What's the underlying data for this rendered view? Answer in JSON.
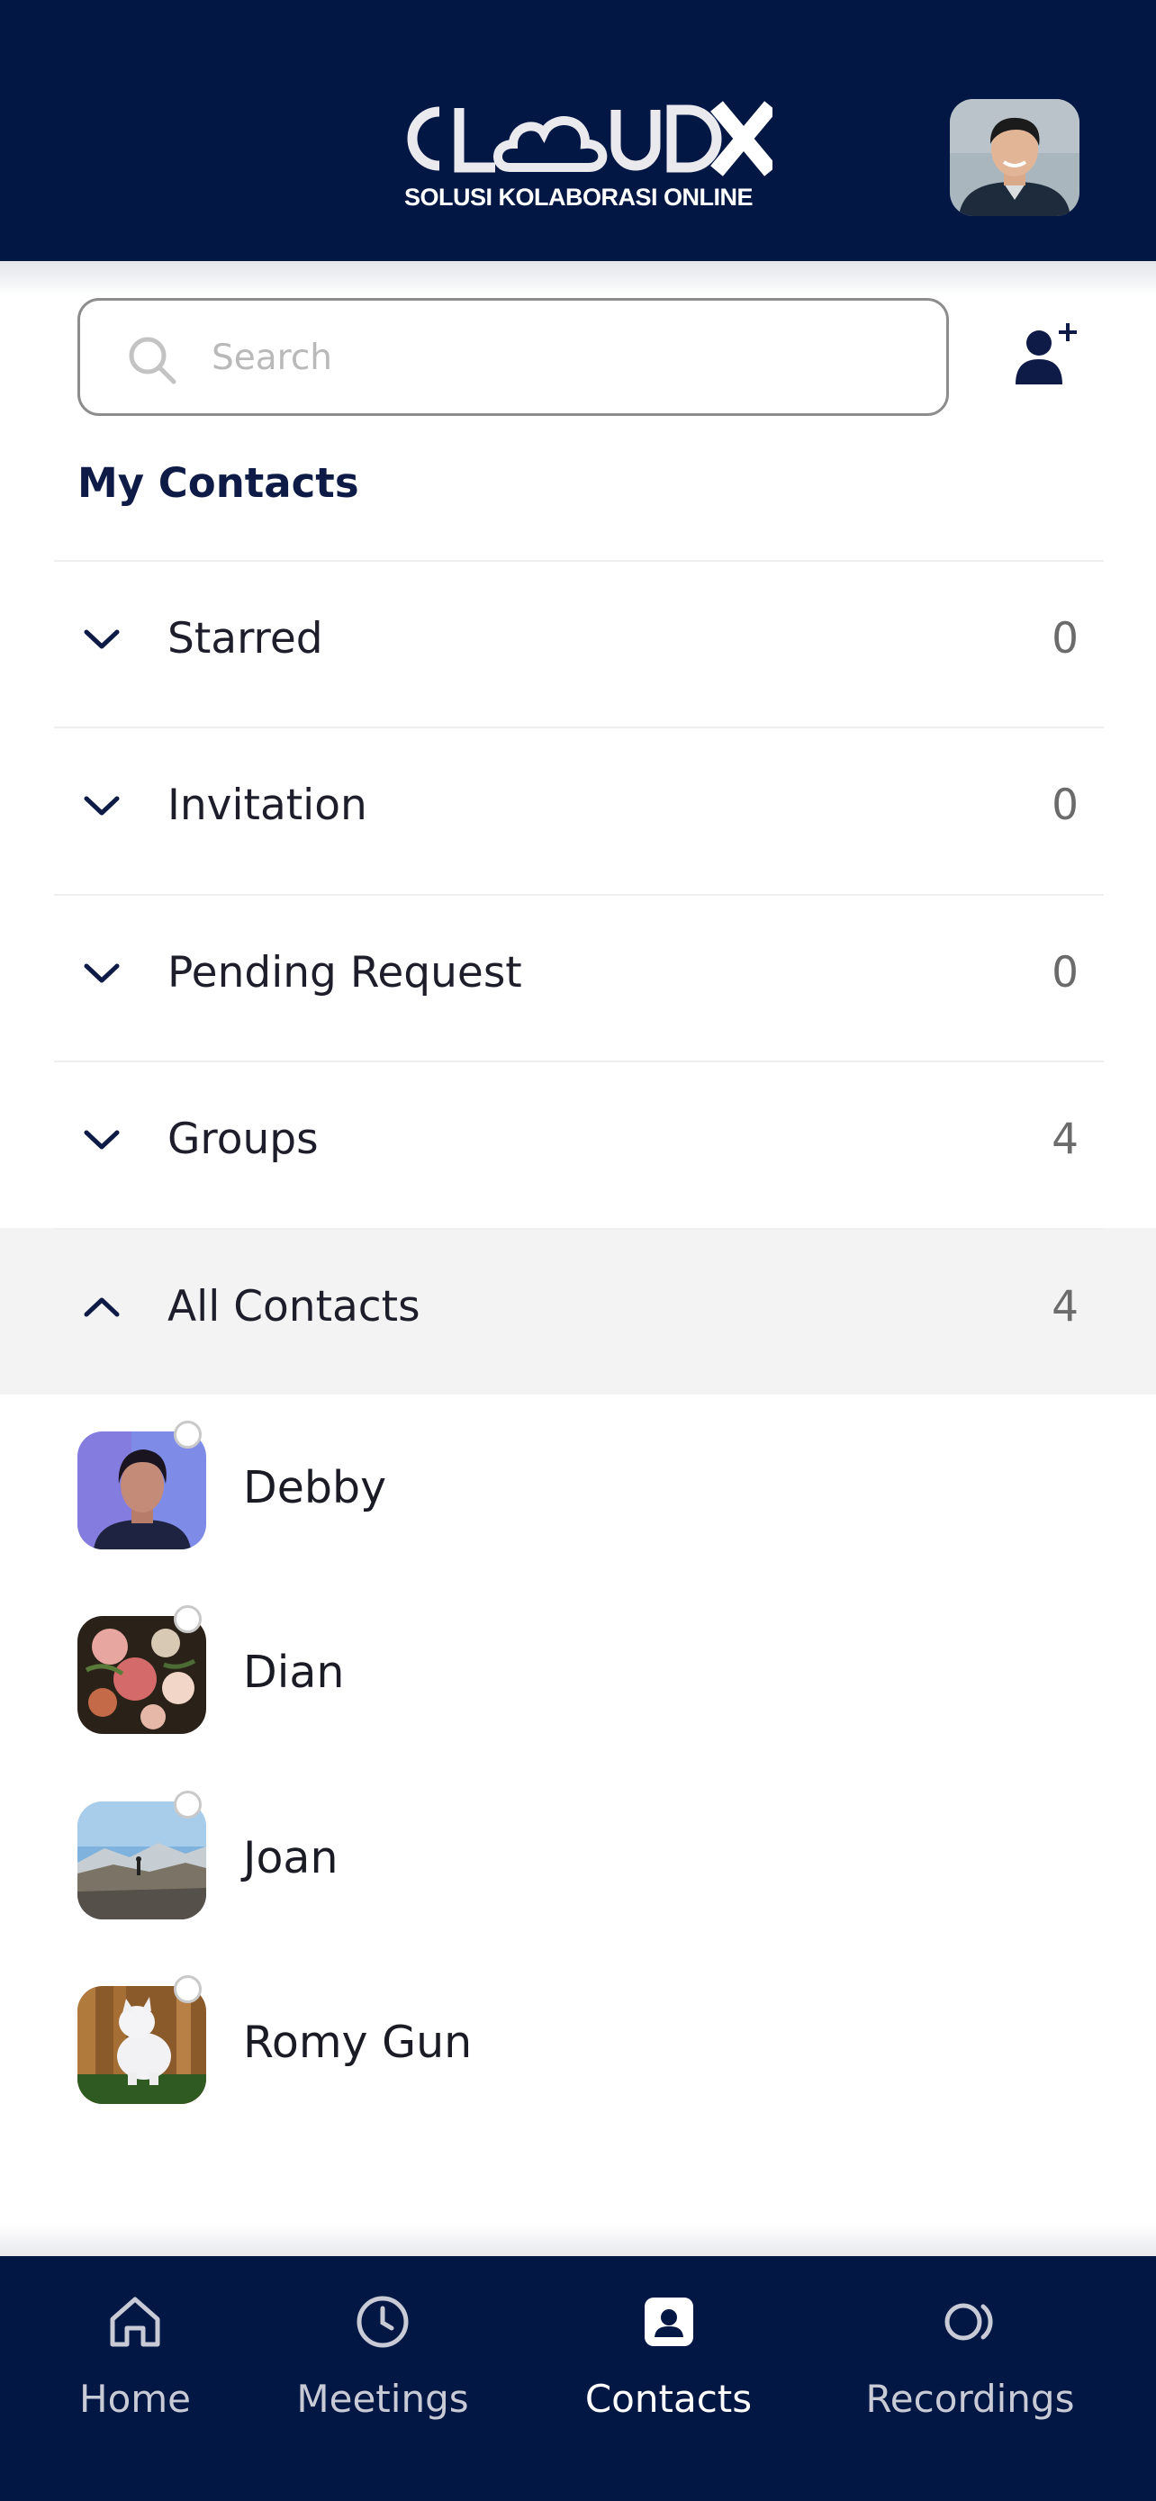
{
  "header": {
    "logo_text": "CLOUDX",
    "logo_tagline": "SOLUSI KOLABORASI ONLINE"
  },
  "search": {
    "placeholder": "Search",
    "value": ""
  },
  "section_title": "My Contacts",
  "categories": [
    {
      "label": "Starred",
      "count": "0",
      "expanded": false
    },
    {
      "label": "Invitation",
      "count": "0",
      "expanded": false
    },
    {
      "label": "Pending Request",
      "count": "0",
      "expanded": false
    },
    {
      "label": "Groups",
      "count": "4",
      "expanded": false
    },
    {
      "label": "All Contacts",
      "count": "4",
      "expanded": true
    }
  ],
  "contacts": [
    {
      "name": "Debby",
      "status": "offline"
    },
    {
      "name": "Dian",
      "status": "offline"
    },
    {
      "name": "Joan",
      "status": "offline"
    },
    {
      "name": "Romy Gun",
      "status": "offline"
    }
  ],
  "bottom_nav": [
    {
      "label": "Home",
      "icon": "home-icon",
      "active": false
    },
    {
      "label": "Meetings",
      "icon": "clock-icon",
      "active": false
    },
    {
      "label": "Contacts",
      "icon": "contact-card-icon",
      "active": true
    },
    {
      "label": "Recordings",
      "icon": "recordings-icon",
      "active": false
    }
  ],
  "colors": {
    "brand_navy": "#031744",
    "title_navy": "#0d1b46",
    "expanded_row_bg": "#f3f3f3"
  }
}
